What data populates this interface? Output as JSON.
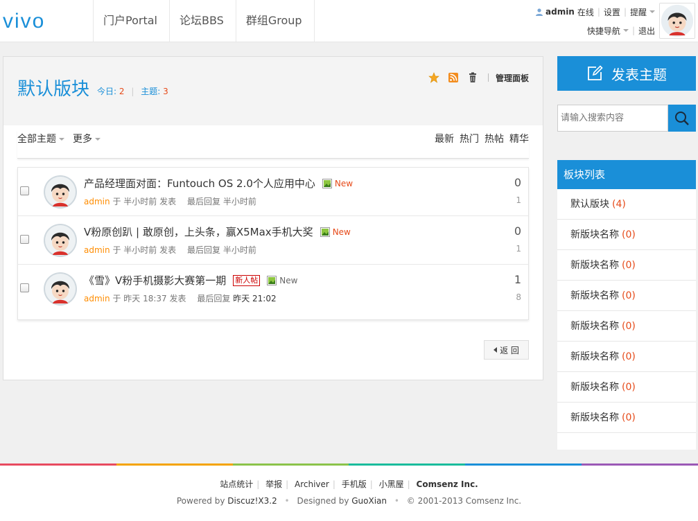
{
  "header": {
    "logo": "vivo",
    "nav": [
      "门户Portal",
      "论坛BBS",
      "群组Group"
    ],
    "user": {
      "name": "admin",
      "status": "在线",
      "settings": "设置",
      "remind": "提醒",
      "quicknav": "快捷导航",
      "logout": "退出"
    }
  },
  "forum": {
    "title": "默认版块",
    "today_label": "今日:",
    "today_value": "2",
    "threads_label": "主题:",
    "threads_value": "3",
    "manage": "管理面板"
  },
  "filter": {
    "left": [
      "全部主题",
      "更多"
    ],
    "right": [
      "最新",
      "热门",
      "热帖",
      "精华"
    ]
  },
  "threads": [
    {
      "title": "产品经理面对面：Funtouch OS 2.0个人应用中心",
      "badge": "",
      "new_label": "New",
      "new_color": "#e64a19",
      "author": "admin",
      "posted_prefix": "于",
      "posted_time": "半小时前",
      "posted_suffix": "发表",
      "last_reply_label": "最后回复",
      "last_reply_time": "半小时前",
      "replies": "0",
      "views": "1"
    },
    {
      "title": "V粉原创趴 | 敢原创，上头条，赢X5Max手机大奖",
      "badge": "",
      "new_label": "New",
      "new_color": "#e64a19",
      "author": "admin",
      "posted_prefix": "于",
      "posted_time": "半小时前",
      "posted_suffix": "发表",
      "last_reply_label": "最后回复",
      "last_reply_time": "半小时前",
      "replies": "0",
      "views": "1"
    },
    {
      "title": "《雪》V粉手机摄影大赛第一期",
      "badge": "新人帖",
      "new_label": "New",
      "new_color": "#666666",
      "author": "admin",
      "posted_prefix": "于",
      "posted_time": "昨天 18:37",
      "posted_suffix": "发表",
      "last_reply_label": "最后回复",
      "last_reply_time": "昨天 21:02",
      "replies": "1",
      "views": "8"
    }
  ],
  "back_button": "返 回",
  "sidebar": {
    "post_button": "发表主题",
    "search_placeholder": "请输入搜索内容",
    "list_title": "板块列表",
    "forums": [
      {
        "name": "默认版块",
        "count": "(4)"
      },
      {
        "name": "新版块名称",
        "count": "(0)"
      },
      {
        "name": "新版块名称",
        "count": "(0)"
      },
      {
        "name": "新版块名称",
        "count": "(0)"
      },
      {
        "name": "新版块名称",
        "count": "(0)"
      },
      {
        "name": "新版块名称",
        "count": "(0)"
      },
      {
        "name": "新版块名称",
        "count": "(0)"
      },
      {
        "name": "新版块名称",
        "count": "(0)"
      }
    ]
  },
  "footer": {
    "links": [
      "站点统计",
      "举报",
      "Archiver",
      "手机版",
      "小黑屋",
      "Comsenz Inc."
    ],
    "powered_label": "Powered by",
    "powered_value": "Discuz!X3.2",
    "designed_label": "Designed by",
    "designed_value": "GuoXian",
    "copyright": "© 2001-2013 Comsenz Inc."
  },
  "colors": {
    "accent": "#1a8fd8",
    "highlight": "#e64a19",
    "author": "#ff8c00",
    "rainbow": [
      "#e84a5f",
      "#f4a300",
      "#8bc34a",
      "#1abc9c",
      "#1a8fd8",
      "#9b59b6"
    ]
  }
}
